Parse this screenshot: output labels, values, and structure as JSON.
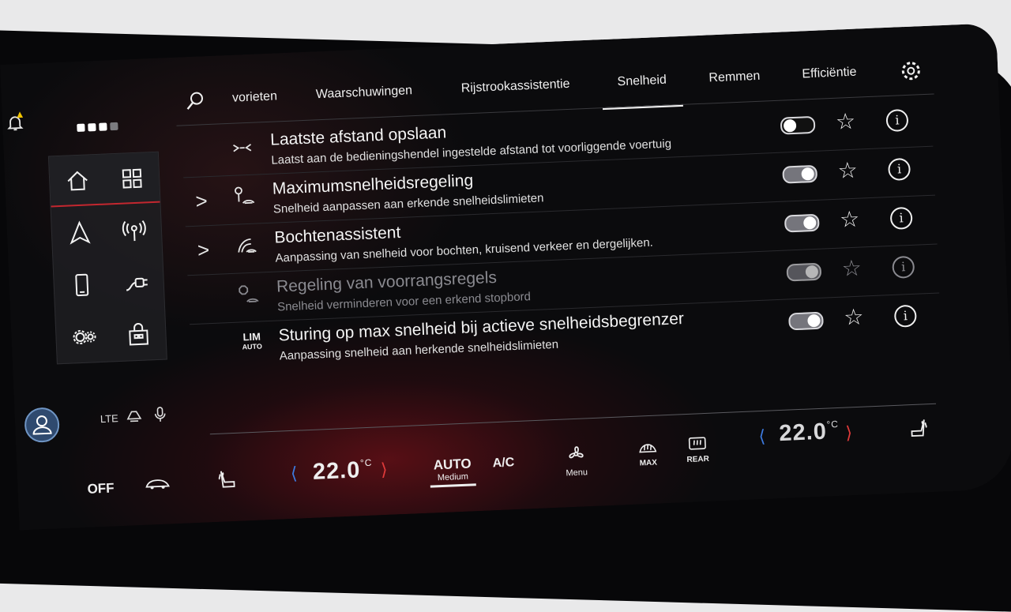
{
  "status": {
    "pager_total": 4,
    "pager_active": 3
  },
  "tabs": [
    {
      "label": "vorieten"
    },
    {
      "label": "Waarschuwingen"
    },
    {
      "label": "Rijstrookassistentie"
    },
    {
      "label": "Snelheid"
    },
    {
      "label": "Remmen"
    },
    {
      "label": "Efficiëntie"
    }
  ],
  "active_tab": "Snelheid",
  "settings": [
    {
      "title": "Laatste afstand opslaan",
      "subtitle": "Laatst aan de bedieningshendel ingestelde afstand tot voorliggende voertuig",
      "toggle": "off",
      "expandable": false,
      "enabled": true
    },
    {
      "title": "Maximumsnelheidsregeling",
      "subtitle": "Snelheid aanpassen aan erkende snelheidslimieten",
      "toggle": "on",
      "expandable": true,
      "enabled": true
    },
    {
      "title": "Bochtenassistent",
      "subtitle": "Aanpassing van snelheid voor bochten, kruisend verkeer en dergelijken.",
      "toggle": "on",
      "expandable": true,
      "enabled": true
    },
    {
      "title": "Regeling van voorrangsregels",
      "subtitle": "Snelheid verminderen voor een erkend stopbord",
      "toggle": "on",
      "expandable": false,
      "enabled": false
    },
    {
      "title": "Sturing op max snelheid bij actieve snelheidsbegrenzer",
      "subtitle": "Aanpassing snelheid aan herkende snelheidslimieten",
      "toggle": "on",
      "expandable": false,
      "enabled": true,
      "icon_text_top": "LIM",
      "icon_text_bottom": "AUTO"
    }
  ],
  "left_bar": {
    "status_lte": "LTE"
  },
  "climate": {
    "off_label": "OFF",
    "left_temp": "22.0",
    "right_temp": "22.0",
    "temp_unit": "°C",
    "auto_label": "AUTO",
    "auto_sub": "Medium",
    "ac_label": "A/C",
    "menu_label": "Menu",
    "max_label": "MAX",
    "rear_label": "REAR"
  },
  "colors": {
    "accent_red": "#c3272f",
    "temp_down": "#3d7be0",
    "temp_up": "#e03a3a"
  }
}
